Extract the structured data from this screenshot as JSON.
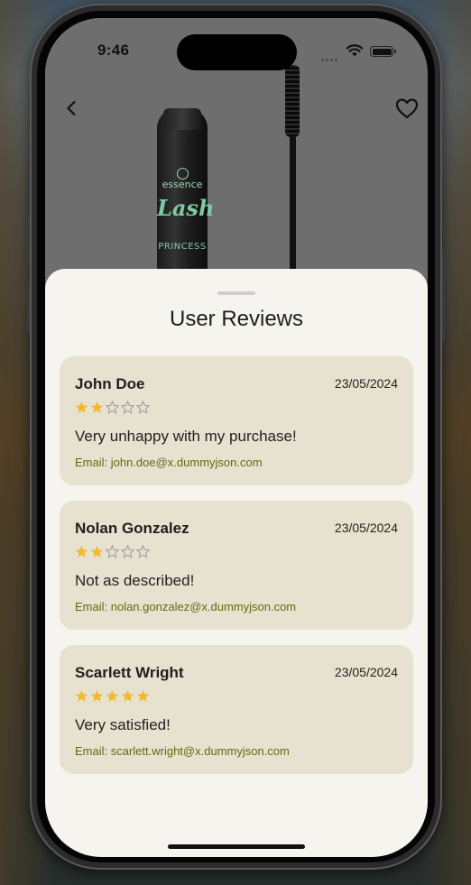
{
  "status_bar": {
    "time": "9:46"
  },
  "header": {
    "back_icon": "chevron-left-icon",
    "favorite_icon": "heart-outline-icon"
  },
  "product_image": {
    "brand": "essence",
    "line_1": "Lash",
    "line_2": "PRINCESS"
  },
  "sheet": {
    "title": "User Reviews",
    "reviews": [
      {
        "name": "John Doe",
        "date": "23/05/2024",
        "rating": 2,
        "max_rating": 5,
        "comment": "Very unhappy with my purchase!",
        "email": "Email: john.doe@x.dummyjson.com"
      },
      {
        "name": "Nolan Gonzalez",
        "date": "23/05/2024",
        "rating": 2,
        "max_rating": 5,
        "comment": "Not as described!",
        "email": "Email: nolan.gonzalez@x.dummyjson.com"
      },
      {
        "name": "Scarlett Wright",
        "date": "23/05/2024",
        "rating": 5,
        "max_rating": 5,
        "comment": "Very satisfied!",
        "email": "Email: scarlett.wright@x.dummyjson.com"
      }
    ]
  },
  "colors": {
    "star_filled": "#f5b82e",
    "star_empty": "#9a9a9a",
    "card_bg": "#e6e2cf",
    "sheet_bg": "#f5f4ef",
    "email_text": "#6e6215"
  }
}
